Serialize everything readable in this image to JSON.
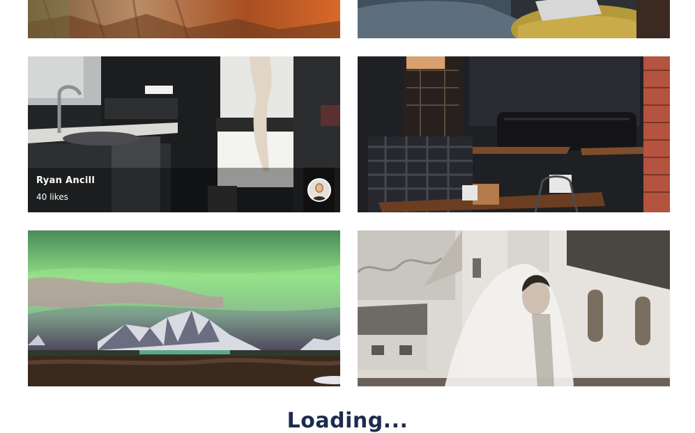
{
  "photos": [
    {
      "id": "canyon",
      "subject": "red rock canyon wall"
    },
    {
      "id": "laptop",
      "subject": "person with laptop on knit pouf"
    },
    {
      "id": "kitchen",
      "subject": "dark kitchen with window curtain"
    },
    {
      "id": "cafe",
      "subject": "cafe interior with leather sofa"
    },
    {
      "id": "aurora",
      "subject": "northern lights over snowy mountain"
    },
    {
      "id": "bride",
      "subject": "bride in veil near white church"
    }
  ],
  "hover_card": {
    "author_name": "Ryan Ancill",
    "likes_text": "40 likes"
  },
  "loading_text": "Loading...",
  "colors": {
    "loading_text": "#1d2c4d",
    "overlay": "rgba(0,0,0,0.38)"
  }
}
